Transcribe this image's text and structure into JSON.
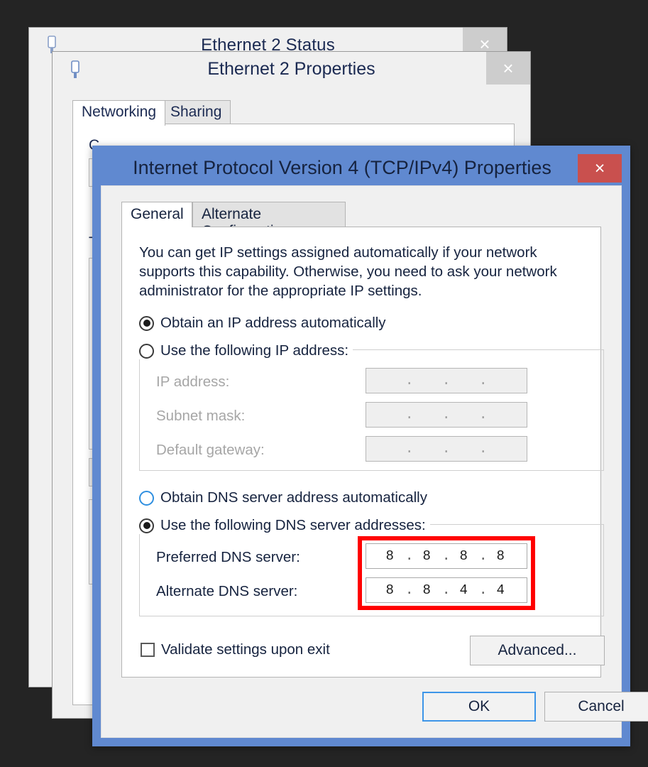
{
  "background_window_status": {
    "title": "Ethernet 2 Status",
    "close_label": "×",
    "icon": "network-adapter-icon"
  },
  "background_window_properties": {
    "title": "Ethernet 2 Properties",
    "close_label": "×",
    "icon": "network-adapter-icon",
    "tabs": [
      {
        "label": "Networking",
        "active": true
      },
      {
        "label": "Sharing",
        "active": false
      }
    ],
    "partial_labels": {
      "connect_using": "C",
      "this_connection": "T"
    }
  },
  "dialog": {
    "title": "Internet Protocol Version 4 (TCP/IPv4) Properties",
    "close_label": "×",
    "tabs": [
      {
        "label": "General",
        "active": true
      },
      {
        "label": "Alternate Configuration",
        "active": false
      }
    ],
    "description": "You can get IP settings assigned automatically if your network supports this capability. Otherwise, you need to ask your network administrator for the appropriate IP settings.",
    "ip_section": {
      "obtain_auto_label": "Obtain an IP address automatically",
      "obtain_auto_selected": true,
      "use_following_label": "Use the following IP address:",
      "use_following_selected": false,
      "fields": [
        {
          "label": "IP address:",
          "value": "",
          "octets": [
            "",
            "",
            "",
            ""
          ],
          "disabled": true
        },
        {
          "label": "Subnet mask:",
          "value": "",
          "octets": [
            "",
            "",
            "",
            ""
          ],
          "disabled": true
        },
        {
          "label": "Default gateway:",
          "value": "",
          "octets": [
            "",
            "",
            "",
            ""
          ],
          "disabled": true
        }
      ]
    },
    "dns_section": {
      "obtain_auto_label": "Obtain DNS server address automatically",
      "obtain_auto_selected": false,
      "use_following_label": "Use the following DNS server addresses:",
      "use_following_selected": true,
      "fields": [
        {
          "label": "Preferred DNS server:",
          "value": "8.8.8.8",
          "octets": [
            "8",
            "8",
            "8",
            "8"
          ],
          "disabled": false
        },
        {
          "label": "Alternate DNS server:",
          "value": "8.8.4.4",
          "octets": [
            "8",
            "8",
            "4",
            "4"
          ],
          "disabled": false
        }
      ],
      "highlight_color": "#ff0000"
    },
    "validate_checkbox": {
      "label": "Validate settings upon exit",
      "checked": false
    },
    "advanced_button": "Advanced...",
    "ok_button": "OK",
    "cancel_button": "Cancel",
    "separator": "."
  },
  "theme": {
    "dialog_frame": "#6089d0",
    "close_red": "#c9504e",
    "page_background": "#242424",
    "text": "#16233f"
  }
}
